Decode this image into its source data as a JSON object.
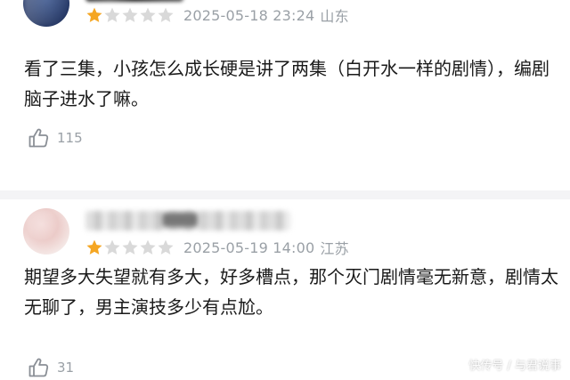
{
  "reviews": [
    {
      "rating": 1,
      "max_rating": 5,
      "date": "2025-05-18 23:24",
      "location": "山东",
      "content": "看了三集，小孩怎么成长硬是讲了两集（白开水一样的剧情），编剧脑子进水了嘛。",
      "likes": "115"
    },
    {
      "rating": 1,
      "max_rating": 5,
      "date": "2025-05-19 14:00",
      "location": "江苏",
      "content": "期望多大失望就有多大，好多槽点，那个灭门剧情毫无新意，剧情太无聊了，男主演技多少有点尬。",
      "likes": "31"
    }
  ],
  "colors": {
    "star_filled": "#f5a623",
    "star_empty": "#d9d9d9",
    "meta_text": "#9aa0a6"
  },
  "icons": {
    "like": "thumbs-up-icon",
    "star": "star-icon"
  },
  "watermark": "快传号 / 与君说事"
}
